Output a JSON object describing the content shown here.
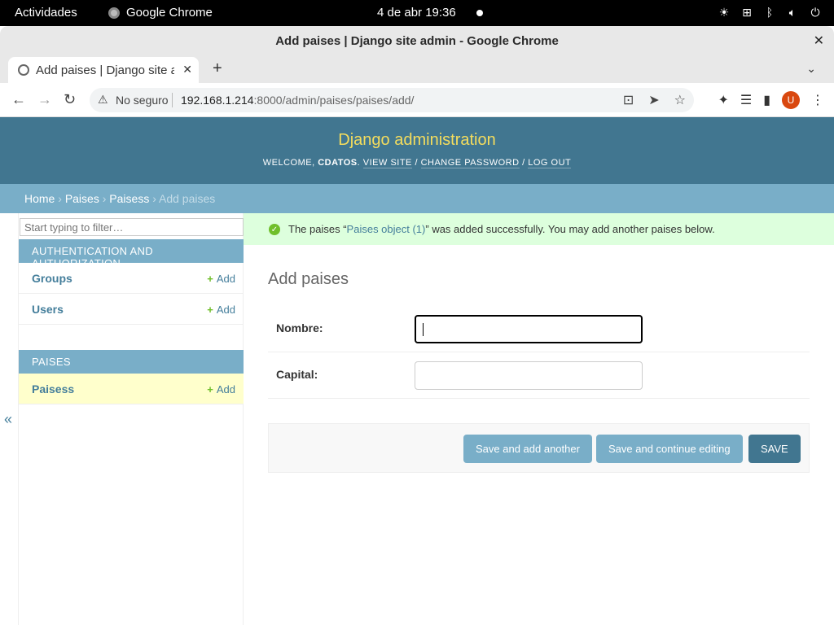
{
  "os": {
    "activities": "Actividades",
    "app_name": "Google Chrome",
    "clock": "4 de abr  19:36"
  },
  "window": {
    "title": "Add paises | Django site admin - Google Chrome",
    "close": "✕"
  },
  "tabs": [
    {
      "title": "Add paises | Django site admin",
      "close": "✕"
    }
  ],
  "tabstrip": {
    "new_tab": "+",
    "tab_search": "⌄"
  },
  "toolbar": {
    "back": "←",
    "forward": "→",
    "reload": "↻",
    "security_label": "No seguro",
    "url_host": "192.168.1.214",
    "url_rest": ":8000/admin/paises/paises/add/",
    "avatar_initial": "U"
  },
  "django": {
    "branding": "Django administration",
    "welcome": "WELCOME,",
    "username": "CDATOS",
    "view_site": "VIEW SITE",
    "change_password": "CHANGE PASSWORD",
    "log_out": "LOG OUT",
    "breadcrumbs": {
      "home": "Home",
      "app": "Paises",
      "model": "Paisess",
      "current": "Add paises"
    },
    "sidebar": {
      "filter_placeholder": "Start typing to filter…",
      "modules": [
        {
          "caption": "AUTHENTICATION AND AUTHORIZATION",
          "models": [
            {
              "name": "Groups",
              "add": "Add"
            },
            {
              "name": "Users",
              "add": "Add"
            }
          ]
        },
        {
          "caption": "PAISES",
          "models": [
            {
              "name": "Paisess",
              "add": "Add"
            }
          ]
        }
      ],
      "collapse_toggle": "«"
    },
    "message": {
      "prefix": "The paises “",
      "link": "Paises object (1)",
      "suffix": "” was added successfully. You may add another paises below."
    },
    "content": {
      "title": "Add paises",
      "fields": [
        {
          "label": "Nombre:",
          "value": ""
        },
        {
          "label": "Capital:",
          "value": ""
        }
      ],
      "buttons": {
        "save_add_another": "Save and add another",
        "save_continue": "Save and continue editing",
        "save": "SAVE"
      }
    }
  },
  "colors": {
    "header": "#417690",
    "breadcrumbs": "#79aec8",
    "brand_text": "#f5dd5d",
    "success_bg": "#ddffdd",
    "link": "#447e9b",
    "add_plus": "#70bf2b"
  }
}
